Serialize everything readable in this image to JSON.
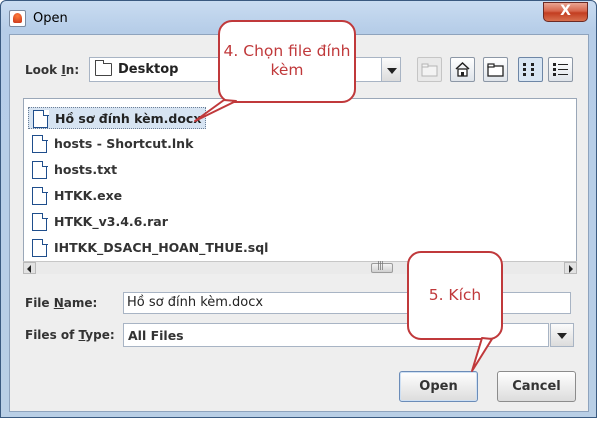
{
  "window": {
    "title": "Open",
    "close_label": "X"
  },
  "toolbar": {
    "look_in_label": "Look In:",
    "look_in_value": "Desktop"
  },
  "files": [
    "Hồ sơ đính kèm.docx",
    "hosts - Shortcut.lnk",
    "hosts.txt",
    "HTKK.exe",
    "HTKK_v3.4.6.rar",
    "IHTKK_DSACH_HOAN_THUE.sql"
  ],
  "selected_index": 0,
  "file_name": {
    "label": "File Name:",
    "value": "Hồ sơ đính kèm.docx"
  },
  "file_type": {
    "label": "Files of Type:",
    "value": "All Files"
  },
  "buttons": {
    "open": "Open",
    "cancel": "Cancel"
  },
  "annotations": {
    "choose_file": "4. Chọn file đính kèm",
    "click": "5. Kích"
  },
  "colors": {
    "callout": "#c0393b",
    "window_frame": "#b6cde8",
    "selection": "#d7e4f2"
  }
}
